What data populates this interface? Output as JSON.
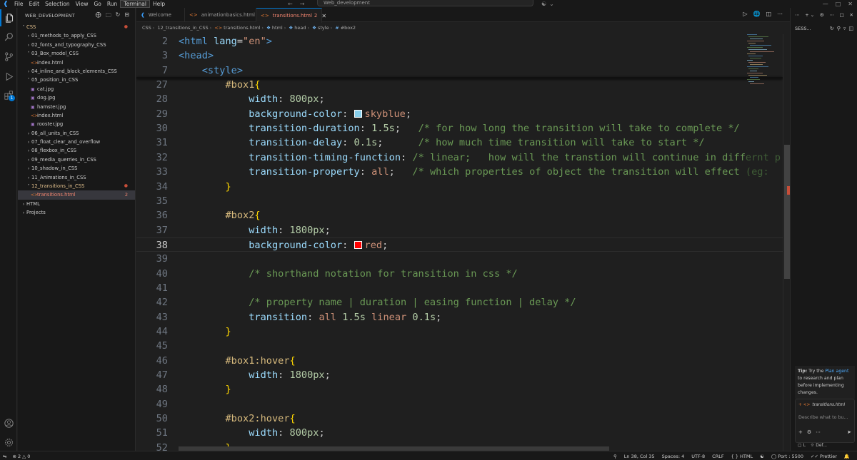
{
  "titlebar": {
    "menus": [
      "File",
      "Edit",
      "Selection",
      "View",
      "Go",
      "Run",
      "Terminal",
      "Help"
    ],
    "search": "Web_development"
  },
  "explorer": {
    "title": "WEB_DEVELOPMENT",
    "tree": [
      {
        "label": "CSS",
        "depth": 0,
        "kind": "folder-open",
        "status": "dot"
      },
      {
        "label": "01_methods_to_apply_CSS",
        "depth": 1,
        "kind": "folder"
      },
      {
        "label": "02_fonts_and_typography_CSS",
        "depth": 1,
        "kind": "folder"
      },
      {
        "label": "03_Box_model_CSS",
        "depth": 1,
        "kind": "folder-open"
      },
      {
        "label": "index.html",
        "depth": 2,
        "kind": "html"
      },
      {
        "label": "04_inline_and_block_elements_CSS",
        "depth": 1,
        "kind": "folder"
      },
      {
        "label": "05_position_in_CSS",
        "depth": 1,
        "kind": "folder-open"
      },
      {
        "label": "cat.jpg",
        "depth": 2,
        "kind": "img"
      },
      {
        "label": "dog.jpg",
        "depth": 2,
        "kind": "img"
      },
      {
        "label": "hamster.jpg",
        "depth": 2,
        "kind": "img"
      },
      {
        "label": "index.html",
        "depth": 2,
        "kind": "html"
      },
      {
        "label": "rooster.jpg",
        "depth": 2,
        "kind": "img"
      },
      {
        "label": "06_all_units_in_CSS",
        "depth": 1,
        "kind": "folder"
      },
      {
        "label": "07_float_clear_and_overflow",
        "depth": 1,
        "kind": "folder"
      },
      {
        "label": "08_flexbox_in_CSS",
        "depth": 1,
        "kind": "folder"
      },
      {
        "label": "09_media_querries_in_CSS",
        "depth": 1,
        "kind": "folder"
      },
      {
        "label": "10_shadow_in_CSS",
        "depth": 1,
        "kind": "folder"
      },
      {
        "label": "11_Animations_in_CSS",
        "depth": 1,
        "kind": "folder"
      },
      {
        "label": "12_transitions_in_CSS",
        "depth": 1,
        "kind": "folder-open",
        "status": "dot"
      },
      {
        "label": "transitions.html",
        "depth": 2,
        "kind": "html",
        "status": "count",
        "count": "2",
        "selected": true
      },
      {
        "label": "HTML",
        "depth": 0,
        "kind": "folder"
      },
      {
        "label": "Projects",
        "depth": 0,
        "kind": "folder"
      }
    ]
  },
  "tabs": [
    {
      "label": "Welcome",
      "icon": "vscode-icon"
    },
    {
      "label": "animationbasics.html",
      "icon": "html-icon"
    },
    {
      "label": "transitions.html",
      "icon": "html-icon",
      "active": true,
      "count": "2"
    }
  ],
  "breadcrumb": [
    "CSS",
    "12_transitions_in_CSS",
    "transitions.html",
    "html",
    "head",
    "style",
    "#box2"
  ],
  "code": [
    {
      "n": "2",
      "sticky": true,
      "tokens": [
        [
          "t-tag",
          "<html "
        ],
        [
          "t-attr",
          "lang"
        ],
        [
          "t-plain",
          "="
        ],
        [
          "t-str",
          "\"en\""
        ],
        [
          "t-tag",
          ">"
        ]
      ]
    },
    {
      "n": "3",
      "sticky": true,
      "tokens": [
        [
          "t-tag",
          "<head>"
        ]
      ]
    },
    {
      "n": "7",
      "sticky": true,
      "tokens": [
        [
          "t-plain",
          "    "
        ],
        [
          "t-tag",
          "<style>"
        ]
      ]
    },
    {
      "n": "27",
      "tokens": [
        [
          "t-plain",
          "        "
        ],
        [
          "t-sel",
          "#box1"
        ],
        [
          "t-brace",
          "{"
        ]
      ]
    },
    {
      "n": "28",
      "tokens": [
        [
          "t-plain",
          "            "
        ],
        [
          "t-prop",
          "width"
        ],
        [
          "t-plain",
          ": "
        ],
        [
          "t-num",
          "800px"
        ],
        [
          "t-plain",
          ";"
        ]
      ]
    },
    {
      "n": "29",
      "tokens": [
        [
          "t-plain",
          "            "
        ],
        [
          "t-prop",
          "background-color"
        ],
        [
          "t-plain",
          ": "
        ],
        [
          "swatch",
          "#87ceeb"
        ],
        [
          "t-val",
          "skyblue"
        ],
        [
          "t-plain",
          ";"
        ]
      ]
    },
    {
      "n": "30",
      "tokens": [
        [
          "t-plain",
          "            "
        ],
        [
          "t-prop",
          "transition-duration"
        ],
        [
          "t-plain",
          ": "
        ],
        [
          "t-num",
          "1.5s"
        ],
        [
          "t-plain",
          ";   "
        ],
        [
          "t-com",
          "/* for how long the transition will take to complete */"
        ]
      ]
    },
    {
      "n": "31",
      "tokens": [
        [
          "t-plain",
          "            "
        ],
        [
          "t-prop",
          "transition-delay"
        ],
        [
          "t-plain",
          ": "
        ],
        [
          "t-num",
          "0.1s"
        ],
        [
          "t-plain",
          ";      "
        ],
        [
          "t-com",
          "/* how much time transition will take to start */"
        ]
      ]
    },
    {
      "n": "32",
      "tokens": [
        [
          "t-plain",
          "            "
        ],
        [
          "t-prop",
          "transition-timing-function"
        ],
        [
          "t-plain",
          ": "
        ],
        [
          "t-com",
          "/* linear;   how will the transtion will continue in diff"
        ],
        [
          "t-fade",
          "ernt p"
        ]
      ]
    },
    {
      "n": "33",
      "tokens": [
        [
          "t-plain",
          "            "
        ],
        [
          "t-prop",
          "transition-property"
        ],
        [
          "t-plain",
          ": "
        ],
        [
          "t-val",
          "all"
        ],
        [
          "t-plain",
          ";   "
        ],
        [
          "t-com",
          "/* which properties of object the transition will effect "
        ],
        [
          "t-fade",
          "(eg: "
        ]
      ]
    },
    {
      "n": "34",
      "tokens": [
        [
          "t-plain",
          "        "
        ],
        [
          "t-brace",
          "}"
        ]
      ]
    },
    {
      "n": "35",
      "tokens": []
    },
    {
      "n": "36",
      "tokens": [
        [
          "t-plain",
          "        "
        ],
        [
          "t-sel",
          "#box2"
        ],
        [
          "t-brace",
          "{"
        ]
      ]
    },
    {
      "n": "37",
      "tokens": [
        [
          "t-plain",
          "            "
        ],
        [
          "t-prop",
          "width"
        ],
        [
          "t-plain",
          ": "
        ],
        [
          "t-num",
          "1800px"
        ],
        [
          "t-plain",
          ";"
        ]
      ]
    },
    {
      "n": "38",
      "current": true,
      "tokens": [
        [
          "t-plain",
          "            "
        ],
        [
          "t-prop",
          "background-color"
        ],
        [
          "t-plain",
          ": "
        ],
        [
          "swatch",
          "#ff0000"
        ],
        [
          "t-val",
          "red"
        ],
        [
          "t-plain",
          ";"
        ]
      ]
    },
    {
      "n": "39",
      "tokens": []
    },
    {
      "n": "40",
      "tokens": [
        [
          "t-plain",
          "            "
        ],
        [
          "t-com",
          "/* shorthand notation for transition in css */"
        ]
      ]
    },
    {
      "n": "41",
      "tokens": []
    },
    {
      "n": "42",
      "tokens": [
        [
          "t-plain",
          "            "
        ],
        [
          "t-com",
          "/* property name | duration | easing function | delay */"
        ]
      ]
    },
    {
      "n": "43",
      "tokens": [
        [
          "t-plain",
          "            "
        ],
        [
          "t-prop",
          "transition"
        ],
        [
          "t-plain",
          ": "
        ],
        [
          "t-val",
          "all "
        ],
        [
          "t-num",
          "1.5s "
        ],
        [
          "t-val",
          "linear "
        ],
        [
          "t-num",
          "0.1s"
        ],
        [
          "t-plain",
          ";"
        ]
      ]
    },
    {
      "n": "44",
      "tokens": [
        [
          "t-plain",
          "        "
        ],
        [
          "t-brace",
          "}"
        ]
      ]
    },
    {
      "n": "45",
      "tokens": []
    },
    {
      "n": "46",
      "tokens": [
        [
          "t-plain",
          "        "
        ],
        [
          "t-sel",
          "#box1:hover"
        ],
        [
          "t-brace",
          "{"
        ]
      ]
    },
    {
      "n": "47",
      "tokens": [
        [
          "t-plain",
          "            "
        ],
        [
          "t-prop",
          "width"
        ],
        [
          "t-plain",
          ": "
        ],
        [
          "t-num",
          "1800px"
        ],
        [
          "t-plain",
          ";"
        ]
      ]
    },
    {
      "n": "48",
      "tokens": [
        [
          "t-plain",
          "        "
        ],
        [
          "t-brace",
          "}"
        ]
      ]
    },
    {
      "n": "49",
      "tokens": []
    },
    {
      "n": "50",
      "tokens": [
        [
          "t-plain",
          "        "
        ],
        [
          "t-sel",
          "#box2:hover"
        ],
        [
          "t-brace",
          "{"
        ]
      ]
    },
    {
      "n": "51",
      "tokens": [
        [
          "t-plain",
          "            "
        ],
        [
          "t-prop",
          "width"
        ],
        [
          "t-plain",
          ": "
        ],
        [
          "t-num",
          "800px"
        ],
        [
          "t-plain",
          ";"
        ]
      ]
    },
    {
      "n": "52",
      "tokens": [
        [
          "t-plain",
          "        "
        ],
        [
          "t-brace",
          "}"
        ]
      ]
    }
  ],
  "chat": {
    "title": "SESS...",
    "tip_prefix": "Tip:",
    "tip_text_1": "Try the",
    "tip_link": "Plan agent",
    "tip_text_2": "to research and plan before implementing changes.",
    "context_file": "transitions.html",
    "placeholder": "Describe what to bu...",
    "mode_label": "L",
    "model_label": "Def..."
  },
  "statusbar": {
    "problems_errors": "2",
    "problems_warnings": "0",
    "position": "Ln 38, Col 35",
    "spaces": "Spaces: 4",
    "encoding": "UTF-8",
    "eol": "CRLF",
    "language": "HTML",
    "port": "Port : 5500",
    "formatter": "Prettier"
  },
  "colors": {
    "accent": "#0078d4",
    "error": "#f48771",
    "modified": "#e2c08d"
  }
}
